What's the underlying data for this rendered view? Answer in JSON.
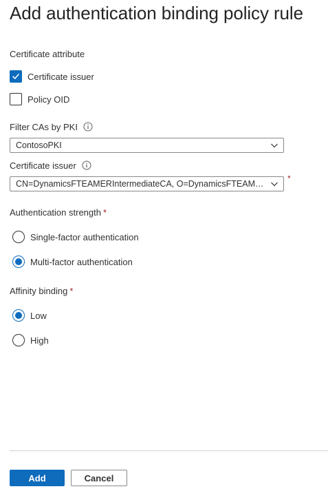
{
  "title": "Add authentication binding policy rule",
  "certificate_attribute": {
    "label": "Certificate attribute",
    "options": [
      {
        "label": "Certificate issuer",
        "checked": true
      },
      {
        "label": "Policy OID",
        "checked": false
      }
    ]
  },
  "filter_cas": {
    "label": "Filter CAs by PKI",
    "icon": "info-icon",
    "value": "ContosoPKI"
  },
  "certificate_issuer": {
    "label": "Certificate issuer",
    "icon": "info-icon",
    "value": "CN=DynamicsFTEAMERIntermediateCA, O=DynamicsFTEAMERIntermediateCA",
    "required_mark": "*"
  },
  "authentication_strength": {
    "label": "Authentication strength",
    "required_mark": "*",
    "options": [
      {
        "label": "Single-factor authentication",
        "selected": false
      },
      {
        "label": "Multi-factor authentication",
        "selected": true
      }
    ]
  },
  "affinity_binding": {
    "label": "Affinity binding",
    "required_mark": "*",
    "options": [
      {
        "label": "Low",
        "selected": true
      },
      {
        "label": "High",
        "selected": false
      }
    ]
  },
  "footer": {
    "add_label": "Add",
    "cancel_label": "Cancel"
  },
  "colors": {
    "accent": "#0f6cbd",
    "required": "#a4262c",
    "text": "#323130",
    "border": "#8a8886"
  }
}
